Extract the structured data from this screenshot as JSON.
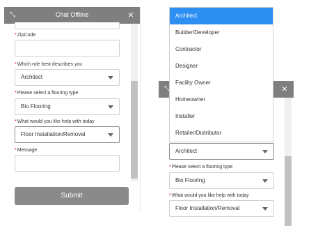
{
  "left_widget": {
    "title": "Chat Offline",
    "minimize_icon": "collapse-arrows-icon",
    "close_icon": "close-icon",
    "fields": {
      "zip": {
        "label": "ZipCode",
        "value": ""
      },
      "role": {
        "label": "Which role best describes you",
        "value": "Architect"
      },
      "flooring": {
        "label": "Please select a flooring type",
        "value": "Bio Flooring"
      },
      "help": {
        "label": "What would you like help with today",
        "value": "Floor Installation/Removal"
      },
      "message": {
        "label": "Message",
        "value": ""
      }
    },
    "required_marker": "*",
    "submit_label": "Submit"
  },
  "right_widget": {
    "role_select": {
      "value": "Architect"
    },
    "flooring": {
      "label": "Please select a flooring type",
      "value": "Bio Flooring"
    },
    "help": {
      "label": "What would you like help with today",
      "value": "Floor Installation/Removal"
    },
    "required_marker": "*",
    "minimize_icon": "collapse-arrows-icon",
    "close_icon": "close-icon",
    "dropdown_options": [
      "Architect",
      "Builder/Developer",
      "Contractor",
      "Designer",
      "Facility Owner",
      "Homeowner",
      "Installer",
      "Retailer/Distributor"
    ],
    "selected_option": "Architect"
  },
  "colors": {
    "header_bg": "#7f7f7f",
    "accent_selected": "#2d8ff2",
    "required": "#d0021b",
    "submit_bg": "#8a8a8a"
  }
}
